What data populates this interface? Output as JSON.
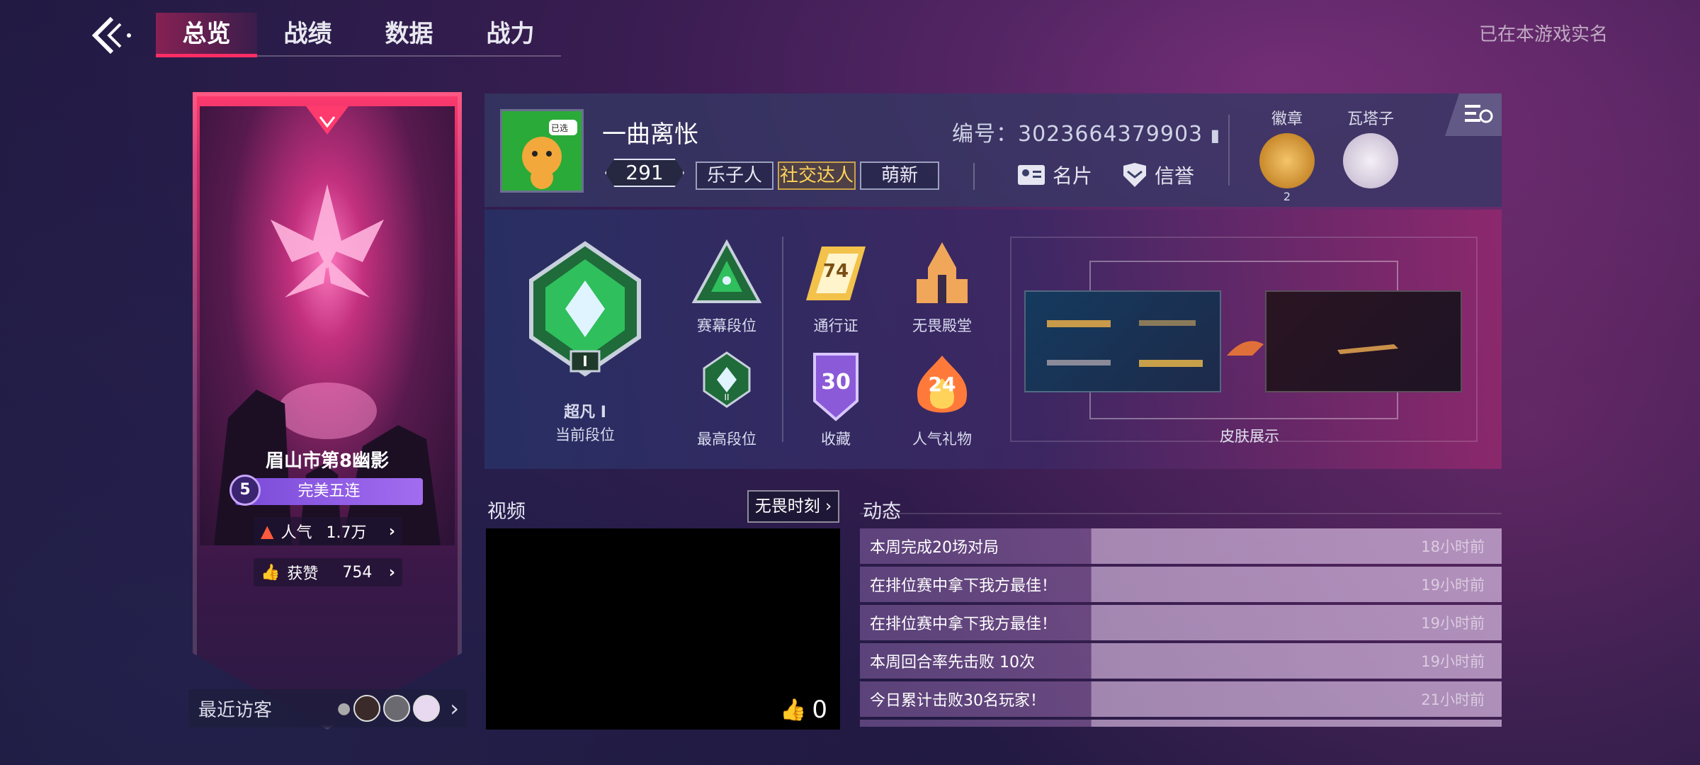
{
  "nav": {
    "tabs": [
      {
        "label": "总览"
      },
      {
        "label": "战绩"
      },
      {
        "label": "数据"
      },
      {
        "label": "战力"
      }
    ],
    "active_tab": "总览",
    "realname_label": "已在本游戏实名"
  },
  "banner": {
    "title": "眉山市第8幽影",
    "streak_num": "5",
    "streak_label": "完美五连",
    "popularity_label": "人气",
    "popularity_value": "1.7万",
    "likes_label": "获赞",
    "likes_value": "754"
  },
  "visitors": {
    "label": "最近访客"
  },
  "profile": {
    "avatar_tag": "已选",
    "name": "一曲离怅",
    "level": "291",
    "tags": [
      "乐子人",
      "社交达人",
      "萌新"
    ],
    "uid_label": "编号：",
    "uid": "3023664379903",
    "card_label": "名片",
    "credit_label": "信誉",
    "badge_label": "徽章",
    "badge_count": "2",
    "tower_label": "瓦塔子"
  },
  "ranks": {
    "current_rank_name": "超凡 I",
    "current_rank_label": "当前段位",
    "current_rank_numeral": "I",
    "season_rank_label": "赛幕段位",
    "highest_rank_label": "最高段位",
    "highest_rank_numeral": "II",
    "pass_label": "通行证",
    "pass_value": "74",
    "hall_label": "无畏殿堂",
    "collection_label": "收藏",
    "collection_value": "30",
    "gift_label": "人气礼物",
    "gift_value": "24",
    "skins_label": "皮肤展示"
  },
  "video": {
    "title": "视频",
    "tag": "无畏时刻",
    "likes": "0"
  },
  "feed": {
    "title": "动态",
    "items": [
      {
        "text": "本周完成20场对局",
        "time": "18小时前"
      },
      {
        "text": "在排位赛中拿下我方最佳！",
        "time": "19小时前"
      },
      {
        "text": "在排位赛中拿下我方最佳！",
        "time": "19小时前"
      },
      {
        "text": "本周回合率先击败 10次",
        "time": "19小时前"
      },
      {
        "text": "今日累计击败30名玩家！",
        "time": "21小时前"
      }
    ]
  },
  "colors": {
    "accent": "#ff2d64",
    "tag_gold": "#ffd35a",
    "streak": "#a36cf0",
    "rank_green": "#2fbf5c"
  },
  "icons": {
    "back": "back-chevron-icon",
    "fire": "fire-icon",
    "thumb": "thumbs-up-icon",
    "chevron": "chevron-right-icon",
    "card": "id-card-icon",
    "credit": "shield-icon",
    "settings": "list-settings-icon",
    "copy": "copy-icon"
  }
}
